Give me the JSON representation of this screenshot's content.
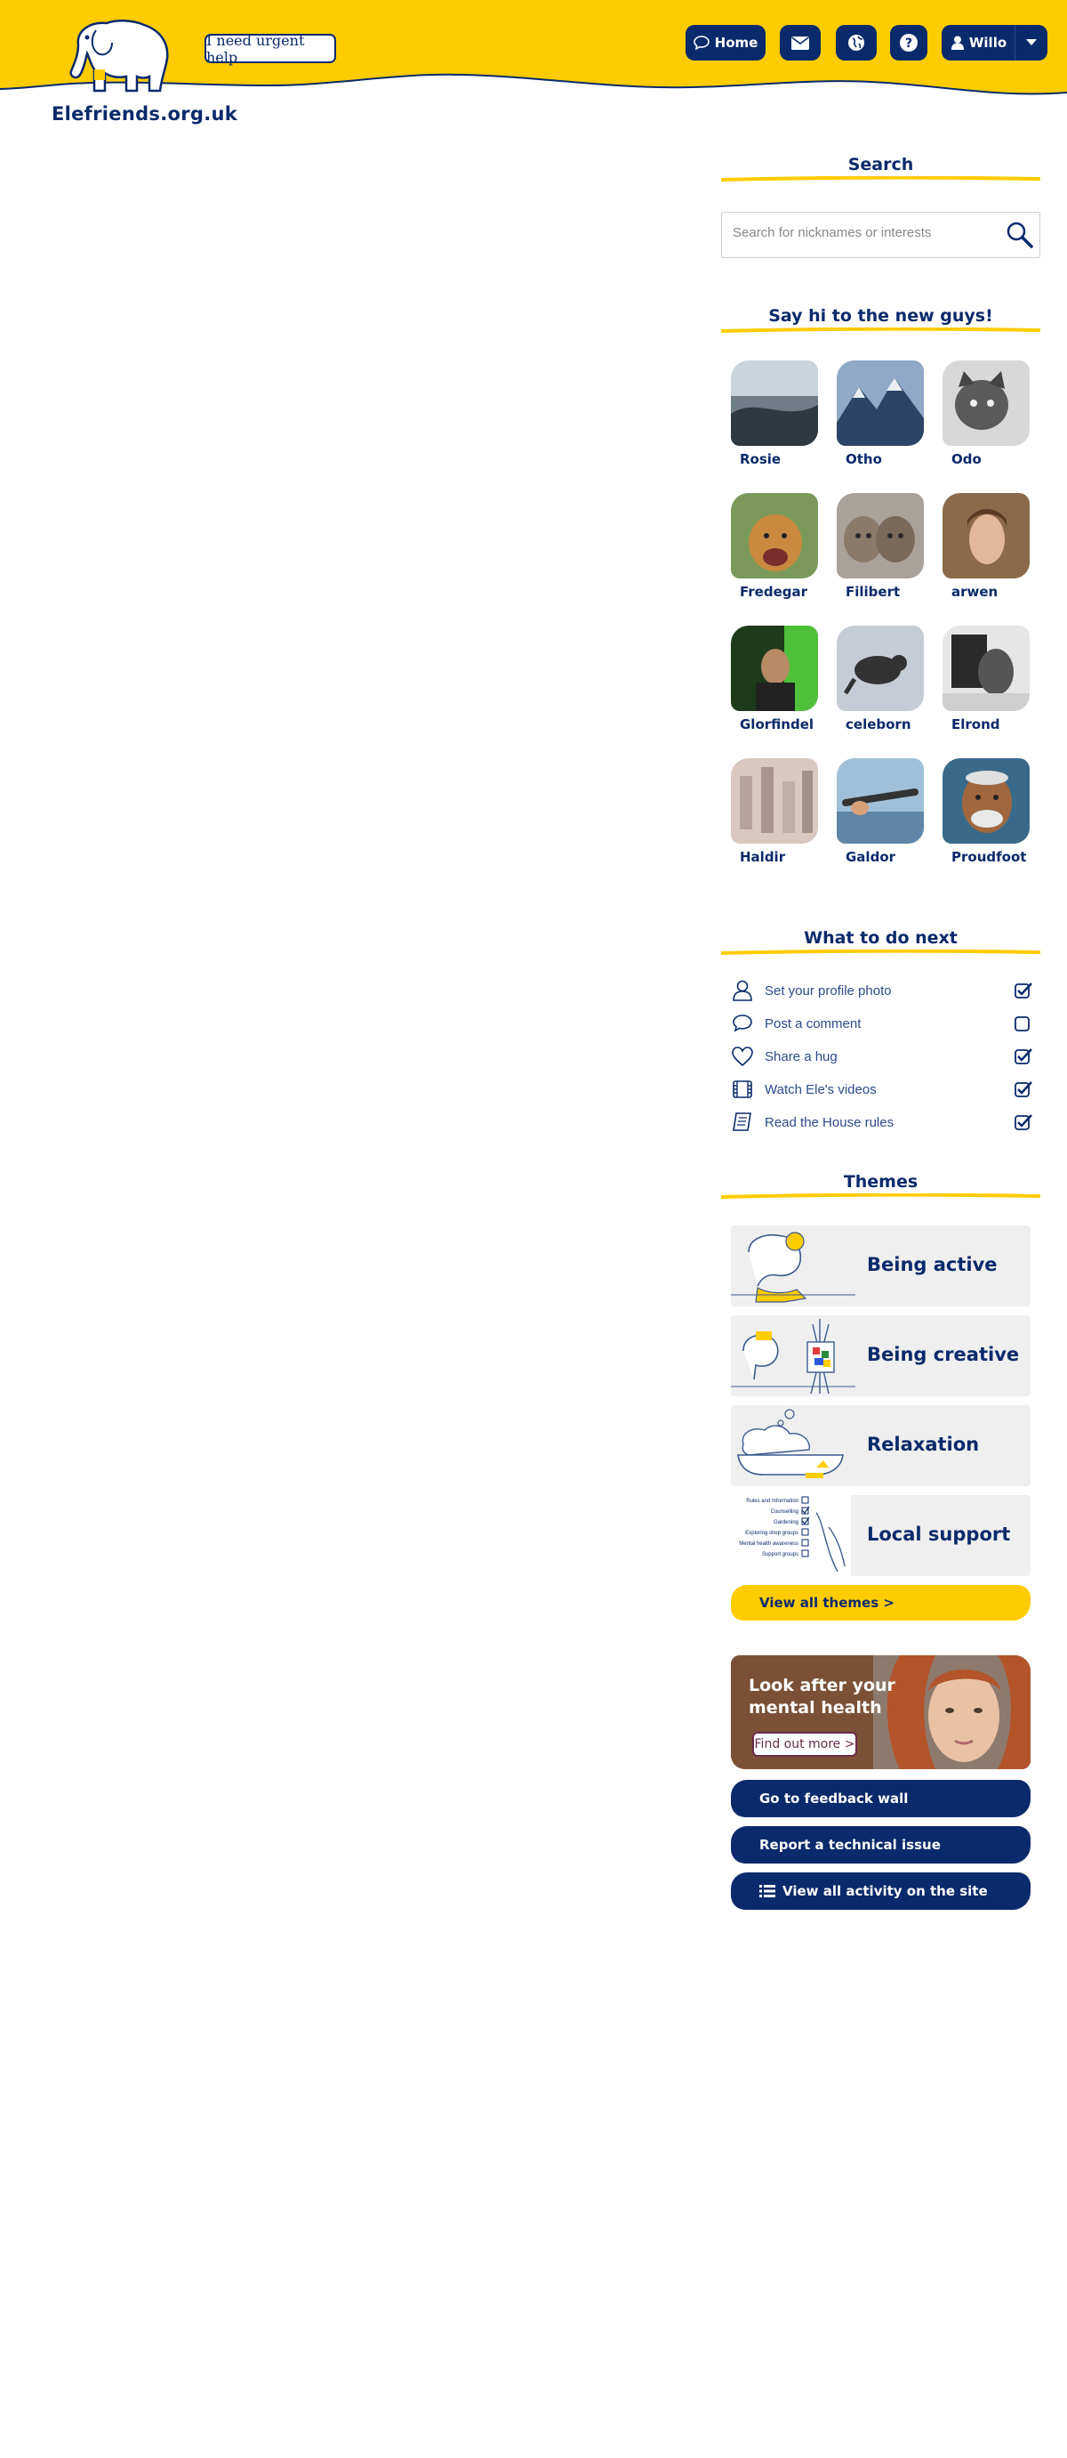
{
  "header": {
    "site_name": "Elefriends.org.uk",
    "urgent_help": "I need urgent help",
    "nav": {
      "home_label": "Home",
      "mail_icon": "envelope-icon",
      "globe_icon": "globe-icon",
      "help_icon": "question-icon",
      "user_label": "Willo",
      "caret_icon": "caret-down-icon"
    },
    "colors": {
      "brand_yellow": "#ffcc00",
      "brand_navy": "#0a2a6b"
    }
  },
  "search": {
    "title": "Search",
    "placeholder": "Search for nicknames or interests"
  },
  "new_users": {
    "title": "Say hi to the new guys!",
    "users": [
      {
        "name": "Rosie"
      },
      {
        "name": "Otho"
      },
      {
        "name": "Odo"
      },
      {
        "name": "Fredegar"
      },
      {
        "name": "Filibert"
      },
      {
        "name": "arwen"
      },
      {
        "name": "Glorfindel"
      },
      {
        "name": "celeborn"
      },
      {
        "name": "Elrond"
      },
      {
        "name": "Haldir"
      },
      {
        "name": "Galdor"
      },
      {
        "name": "Proudfoot"
      }
    ]
  },
  "todo": {
    "title": "What to do next",
    "items": [
      {
        "label": "Set your profile photo",
        "icon": "person-icon",
        "done": true
      },
      {
        "label": "Post a comment",
        "icon": "speech-bubble-icon",
        "done": false
      },
      {
        "label": "Share a hug",
        "icon": "heart-icon",
        "done": true
      },
      {
        "label": "Watch Ele's videos",
        "icon": "film-icon",
        "done": true
      },
      {
        "label": "Read the House rules",
        "icon": "book-icon",
        "done": true
      }
    ]
  },
  "themes": {
    "title": "Themes",
    "items": [
      {
        "label": "Being active"
      },
      {
        "label": "Being creative"
      },
      {
        "label": "Relaxation"
      },
      {
        "label": "Local support"
      }
    ],
    "view_all": "View all themes >",
    "local_support_list": [
      "Rules and Information",
      "Counselling",
      "Gardening",
      "Exploring shop groups",
      "Mental health awareness",
      "Support groups"
    ]
  },
  "promo": {
    "title": "Look after your mental health",
    "button": "Find out more >"
  },
  "actions": {
    "feedback": "Go to feedback wall",
    "report": "Report a technical issue",
    "activity": "View all activity on the site"
  }
}
